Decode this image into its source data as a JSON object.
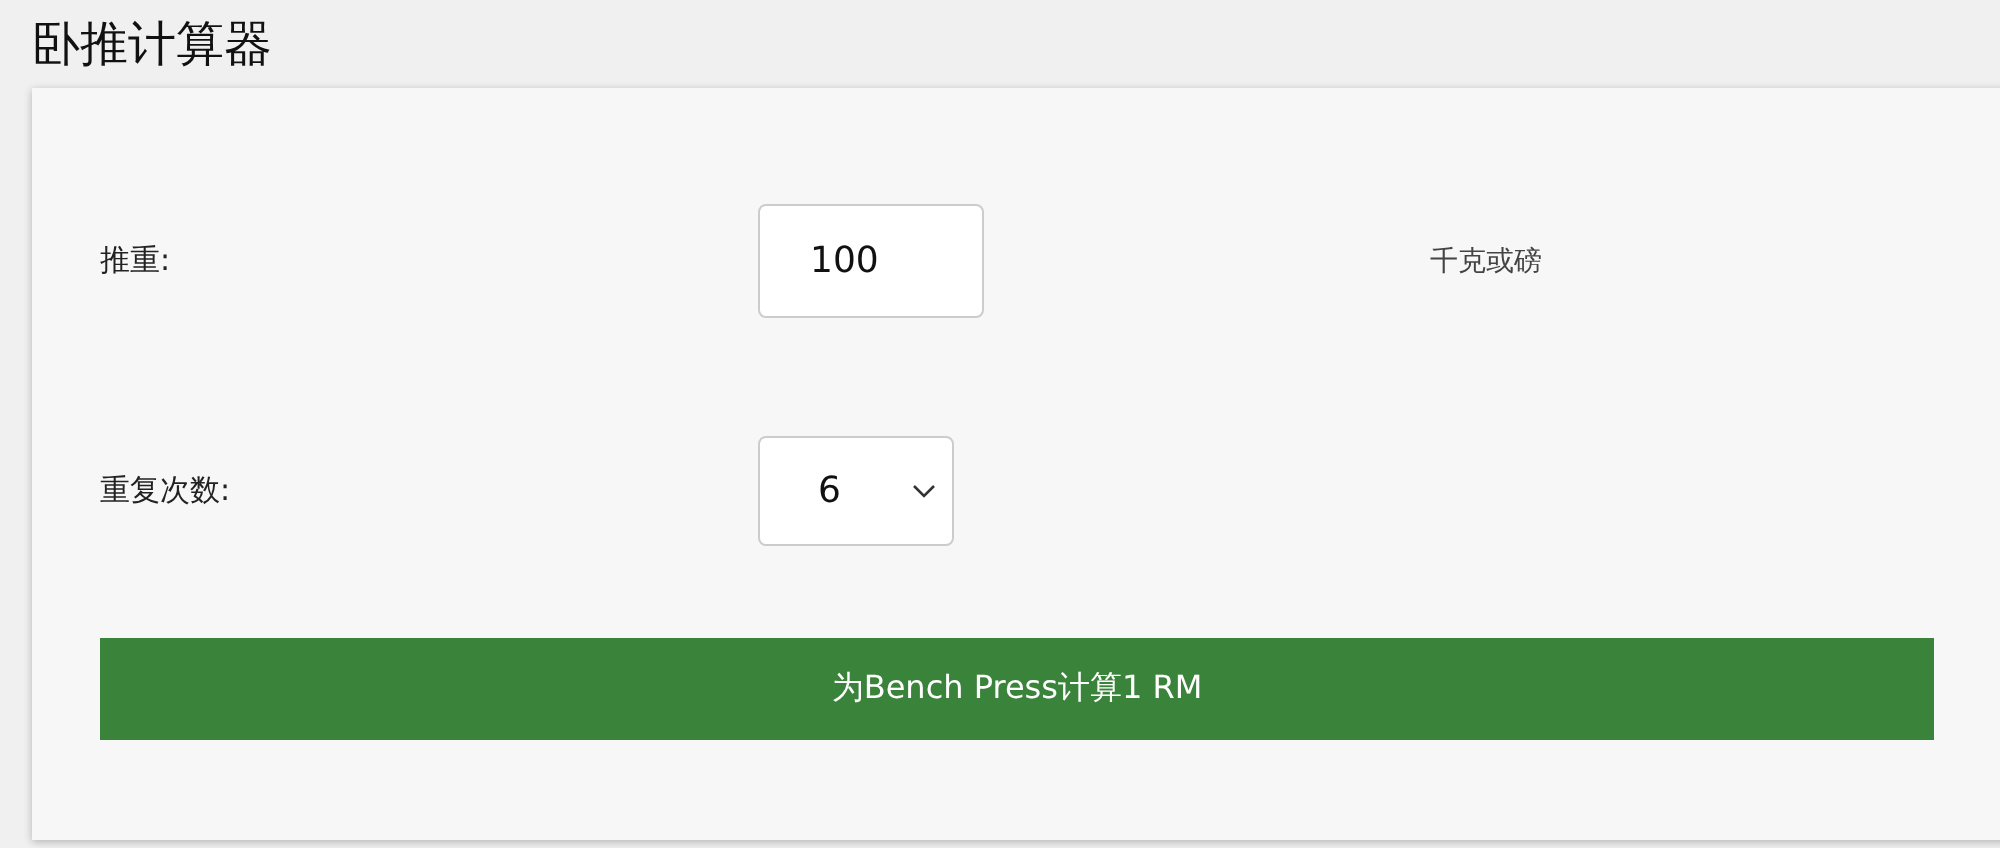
{
  "title": "卧推计算器",
  "fields": [
    {
      "kind": "input",
      "label": "推重:",
      "value": "100",
      "unit": "千克或磅"
    },
    {
      "kind": "select",
      "label": "重复次数:",
      "value": "6"
    }
  ],
  "button": "为Bench Press计算1 RM"
}
